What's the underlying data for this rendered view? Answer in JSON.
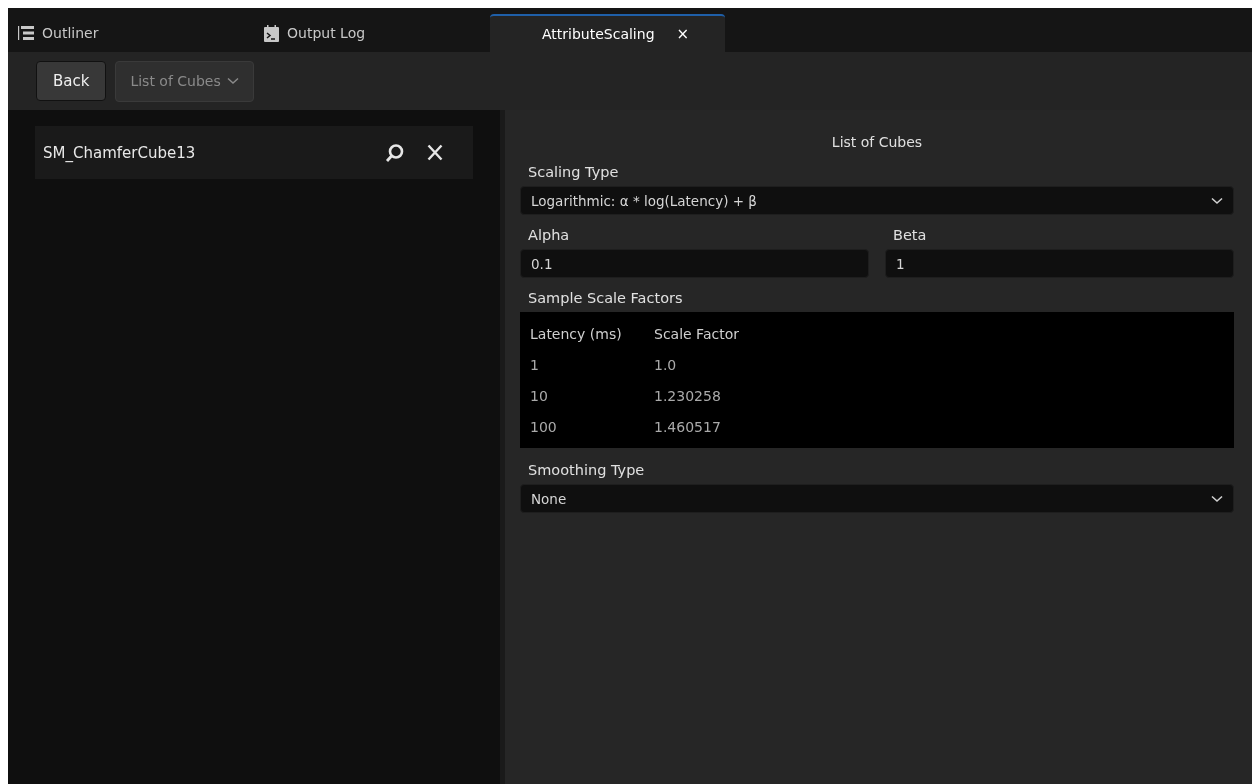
{
  "tabs": [
    {
      "label": "Outliner",
      "kind": "outliner",
      "selected": false
    },
    {
      "label": "Output Log",
      "kind": "log",
      "selected": false
    },
    {
      "label": "AttributeScaling",
      "kind": "document",
      "selected": true,
      "close": "×"
    }
  ],
  "toolbar": {
    "back_button": "Back",
    "dropdown": {
      "value": "List of Cubes",
      "disabled": true
    }
  },
  "list": [
    {
      "name": "SM_ChamferCube13"
    }
  ],
  "panel": {
    "title": "List of Cubes",
    "scaling_type": {
      "label": "Scaling Type",
      "value": "Logarithmic: α * log(Latency) + β"
    },
    "alpha": {
      "label": "Alpha",
      "value": "0.1"
    },
    "beta": {
      "label": "Beta",
      "value": "1"
    },
    "samples": {
      "label": "Sample Scale Factors",
      "columns": [
        "Latency (ms)",
        "Scale Factor"
      ],
      "rows": [
        [
          "1",
          "1.0"
        ],
        [
          "10",
          "1.230258"
        ],
        [
          "100",
          "1.460517"
        ]
      ]
    },
    "smoothing_type": {
      "label": "Smoothing Type",
      "value": "None"
    }
  }
}
